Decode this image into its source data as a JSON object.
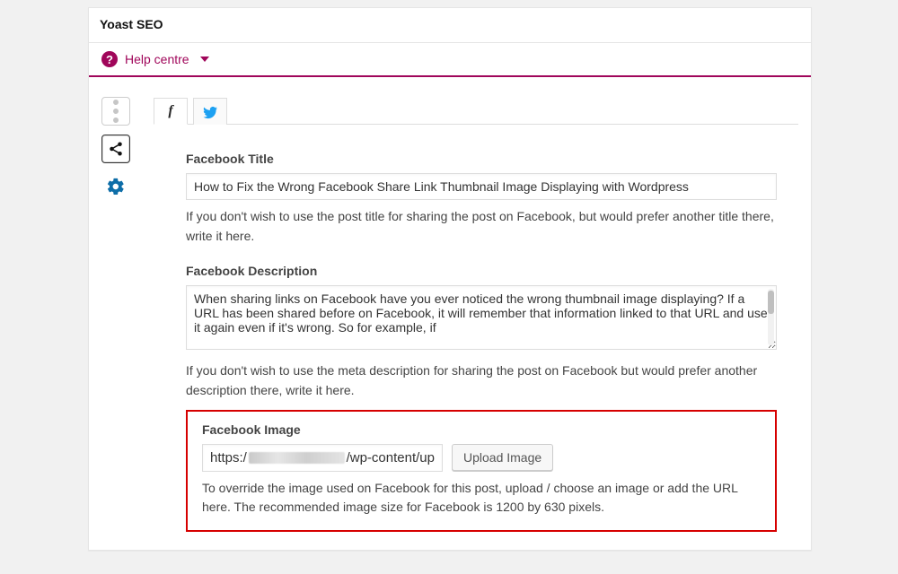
{
  "header": {
    "title": "Yoast SEO"
  },
  "help": {
    "label": "Help centre"
  },
  "fields": {
    "fb_title_label": "Facebook Title",
    "fb_title_value": "How to Fix the Wrong Facebook Share Link Thumbnail Image Displaying with Wordpress",
    "fb_title_help": "If you don't wish to use the post title for sharing the post on Facebook, but would prefer another title there, write it here.",
    "fb_desc_label": "Facebook Description",
    "fb_desc_value": "When sharing links on Facebook have you ever noticed the wrong thumbnail image displaying? If a URL has been shared before on Facebook, it will remember that information linked to that URL and use it again even if it's wrong. So for example, if",
    "fb_desc_help": "If you don't wish to use the meta description for sharing the post on Facebook but would prefer another description there, write it here.",
    "fb_image_label": "Facebook Image",
    "fb_image_prefix": "https:/",
    "fb_image_suffix": "/wp-content/up",
    "upload_label": "Upload Image",
    "fb_image_help": "To override the image used on Facebook for this post, upload / choose an image or add the URL here. The recommended image size for Facebook is 1200 by 630 pixels."
  },
  "icons": {
    "facebook_letter": "f"
  }
}
